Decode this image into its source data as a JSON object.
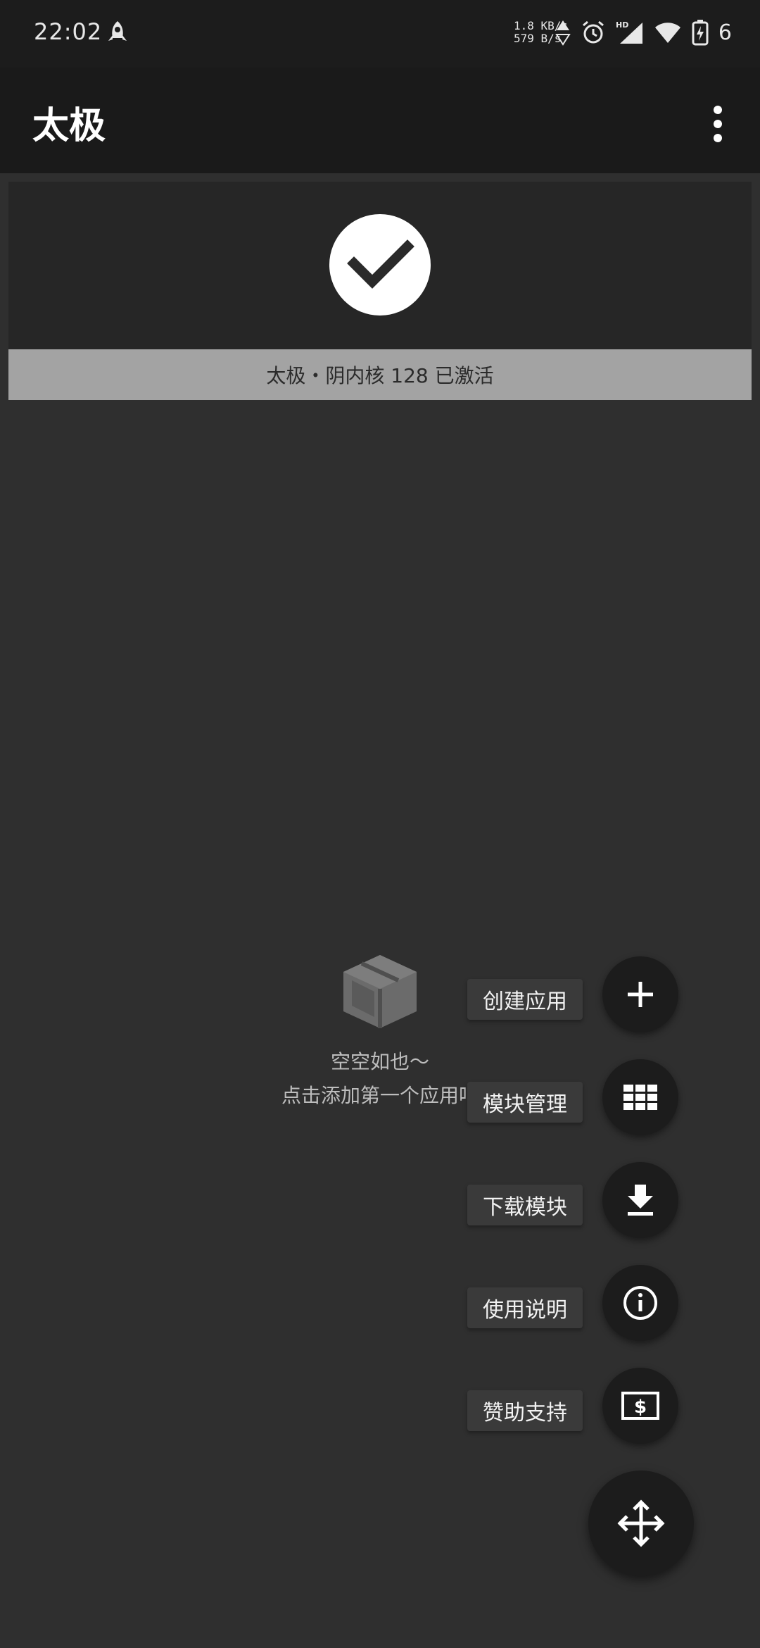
{
  "status_bar": {
    "time": "22:02",
    "net_up": "1.8 KB/s",
    "net_down": "579 B/s",
    "battery_level": "6",
    "icons": [
      "notification-rocket-icon",
      "alarm-icon",
      "hd-signal-icon",
      "wifi-icon",
      "battery-charging-icon"
    ]
  },
  "app_bar": {
    "title": "太极"
  },
  "status_card": {
    "status_text": "太极・阴内核 128 已激活"
  },
  "empty_state": {
    "line1": "空空如也～",
    "line2": "点击添加第一个应用吧"
  },
  "fab_menu": {
    "items": [
      {
        "label": "创建应用",
        "icon": "plus-icon"
      },
      {
        "label": "模块管理",
        "icon": "grid-icon"
      },
      {
        "label": "下载模块",
        "icon": "download-icon"
      },
      {
        "label": "使用说明",
        "icon": "info-icon"
      },
      {
        "label": "赞助支持",
        "icon": "money-icon"
      }
    ],
    "main_icon": "move-arrows-icon"
  },
  "colors": {
    "background": "#2f2f2f",
    "app_bar": "#1a1a1a",
    "banner": "#a3a3a3",
    "fab": "#1c1c1c"
  }
}
